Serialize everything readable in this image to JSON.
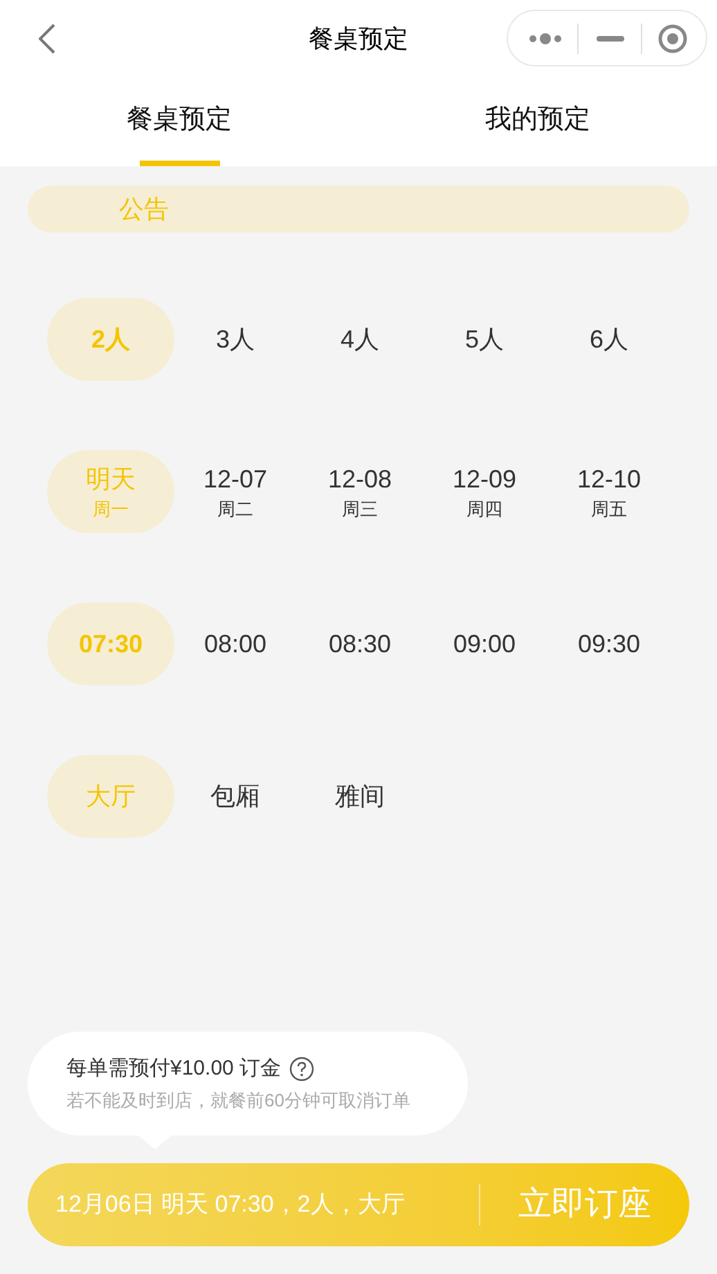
{
  "nav": {
    "title": "餐桌预定"
  },
  "tabs": [
    {
      "label": "餐桌预定",
      "selected": true
    },
    {
      "label": "我的预定",
      "selected": false
    }
  ],
  "notice": {
    "text": "公告"
  },
  "groups": [
    {
      "options": [
        {
          "label": "2人",
          "selected": true
        },
        {
          "label": "3人",
          "selected": false
        },
        {
          "label": "4人",
          "selected": false
        },
        {
          "label": "5人",
          "selected": false
        },
        {
          "label": "6人",
          "selected": false
        }
      ]
    },
    {
      "options": [
        {
          "label": "明天",
          "sub": "周一",
          "selected": true
        },
        {
          "label": "12-07",
          "sub": "周二",
          "selected": false
        },
        {
          "label": "12-08",
          "sub": "周三",
          "selected": false
        },
        {
          "label": "12-09",
          "sub": "周四",
          "selected": false
        },
        {
          "label": "12-10",
          "sub": "周五",
          "selected": false
        }
      ]
    },
    {
      "options": [
        {
          "label": "07:30",
          "selected": true
        },
        {
          "label": "08:00",
          "selected": false
        },
        {
          "label": "08:30",
          "selected": false
        },
        {
          "label": "09:00",
          "selected": false
        },
        {
          "label": "09:30",
          "selected": false
        }
      ]
    },
    {
      "options": [
        {
          "label": "大厅",
          "selected": true
        },
        {
          "label": "包厢",
          "selected": false
        },
        {
          "label": "雅间",
          "selected": false
        }
      ]
    }
  ],
  "tip": {
    "title": "每单需预付¥10.00 订金",
    "note": "若不能及时到店，就餐前60分钟可取消订单"
  },
  "bar": {
    "summary": "12月06日 明天 07:30，2人，大厅",
    "button": "立即订座"
  }
}
